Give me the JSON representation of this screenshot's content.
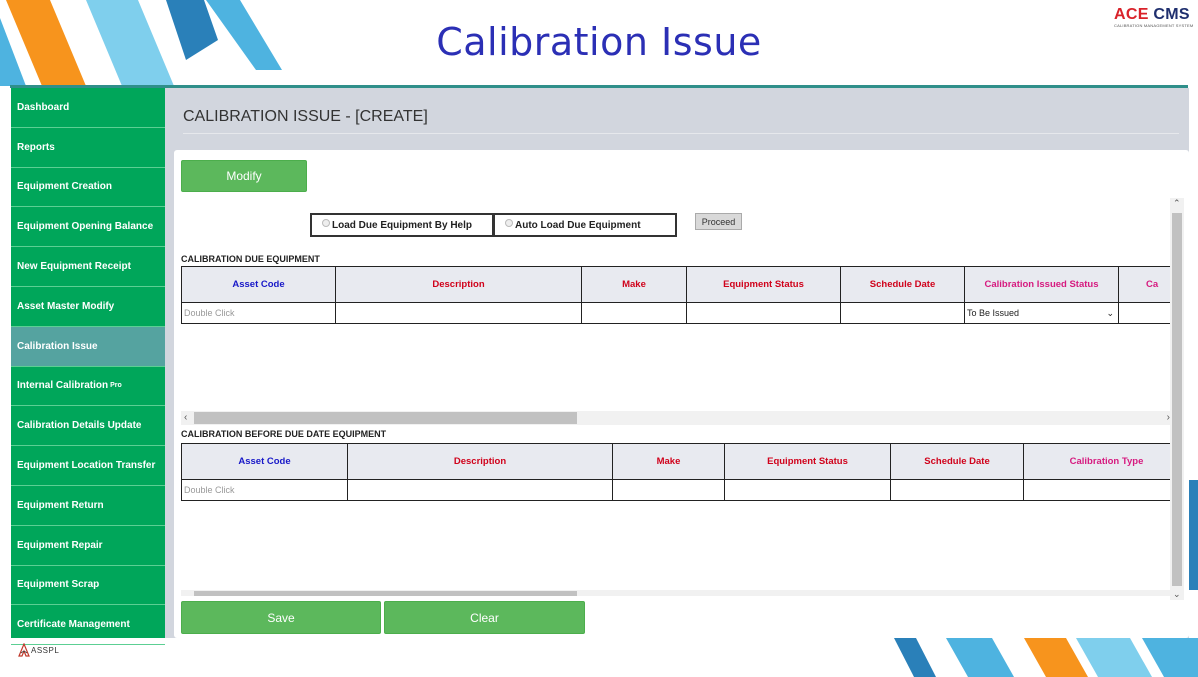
{
  "banner": {
    "title": "Calibration Issue"
  },
  "logo": {
    "main_ace": "ACE",
    "main_cms": " CMS",
    "subtitle": "CALIBRATION MANAGEMENT SYSTEM"
  },
  "footer_brand": "ASSPL",
  "sidebar": {
    "items": [
      {
        "label": "Dashboard"
      },
      {
        "label": "Reports"
      },
      {
        "label": "Equipment Creation"
      },
      {
        "label": "Equipment Opening Balance"
      },
      {
        "label": "New Equipment Receipt"
      },
      {
        "label": "Asset Master Modify"
      },
      {
        "label": "Calibration Issue"
      },
      {
        "label": "Internal Calibration",
        "sup": "Pro"
      },
      {
        "label": "Calibration Details Update"
      },
      {
        "label": "Equipment Location Transfer"
      },
      {
        "label": "Equipment Return"
      },
      {
        "label": "Equipment Repair"
      },
      {
        "label": "Equipment Scrap"
      },
      {
        "label": "Certificate Management"
      }
    ]
  },
  "main": {
    "header": "CALIBRATION ISSUE - [CREATE]",
    "modify_label": "Modify",
    "radio_help": "Load Due Equipment By Help",
    "radio_auto": "Auto Load Due Equipment",
    "proceed_label": "Proceed",
    "due_section_title": "CALIBRATION DUE EQUIPMENT",
    "due_table": {
      "headers": [
        "Asset Code",
        "Description",
        "Make",
        "Equipment Status",
        "Schedule Date",
        "Calibration Issued Status",
        "Ca"
      ],
      "row": {
        "asset_code_placeholder": "Double Click",
        "issued_status": "To Be Issued"
      }
    },
    "before_section_title": "CALIBRATION BEFORE DUE DATE EQUIPMENT",
    "before_table": {
      "headers": [
        "Asset Code",
        "Description",
        "Make",
        "Equipment Status",
        "Schedule Date",
        "Calibration Type"
      ],
      "row": {
        "asset_code_placeholder": "Double Click"
      }
    },
    "save_label": "Save",
    "clear_label": "Clear"
  },
  "colors": {
    "sidebar": "#00a65a",
    "sidebar_active": "#55a3a0",
    "title": "#2b2fb5",
    "button": "#5cb85c"
  }
}
